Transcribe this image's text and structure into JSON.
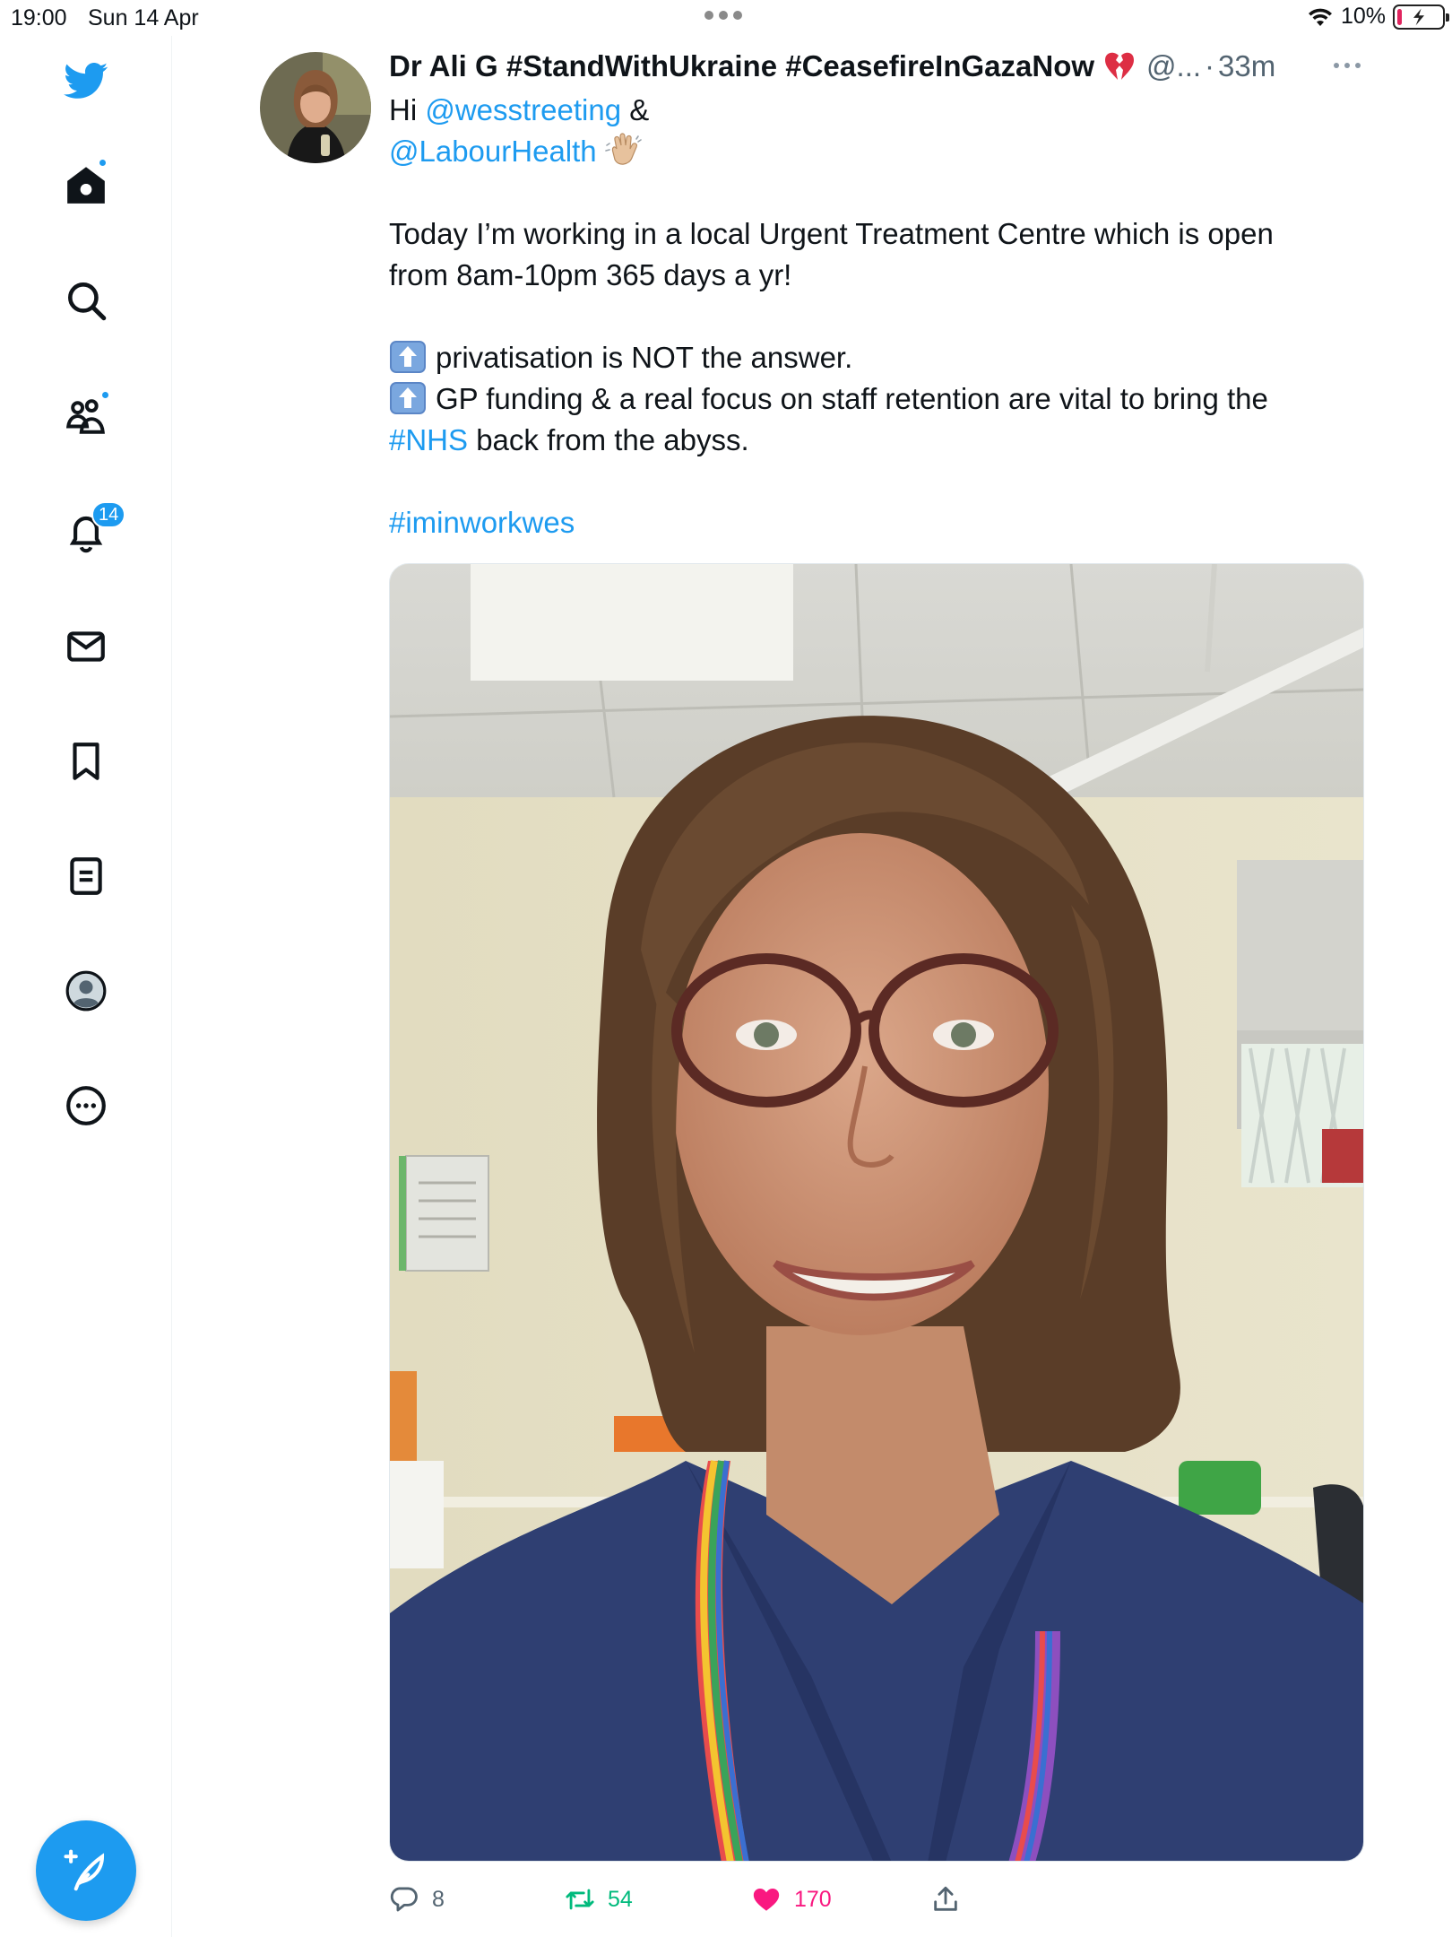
{
  "status_bar": {
    "time": "19:00",
    "date": "Sun 14 Apr",
    "battery": "10%",
    "battery_level": 0.1
  },
  "sidebar": {
    "notifications_badge": "14",
    "items": [
      {
        "name": "twitter-logo-icon"
      },
      {
        "name": "home-icon"
      },
      {
        "name": "search-icon"
      },
      {
        "name": "communities-icon"
      },
      {
        "name": "notifications-bell-icon"
      },
      {
        "name": "messages-envelope-icon"
      },
      {
        "name": "bookmark-icon"
      },
      {
        "name": "lists-icon"
      },
      {
        "name": "profile-icon"
      },
      {
        "name": "more-icon"
      }
    ],
    "compose_icon": "compose-feather-icon"
  },
  "tweet": {
    "display_name": "Dr Ali G #StandWithUkraine #CeasefireInGazaNow",
    "name_emoji": "broken-heart-icon",
    "handle": "@...",
    "separator": "·",
    "time": "33m",
    "body": {
      "greeting_prefix": "Hi ",
      "mention_1": "@wesstreeting",
      "greeting_suffix": " &",
      "mention_2": "@LabourHealth",
      "wave_emoji": "waving-hand-icon",
      "line_1": "Today I’m working in a local Urgent Treatment Centre which is open",
      "line_2": "from 8am-10pm 365 days a yr!",
      "bullet_emoji": "up-arrow-emoji-icon",
      "line_3": "privatisation is NOT the answer.",
      "line_4": "GP funding & a real focus on staff retention are vital to bring the",
      "hashtag_nhs": "#NHS",
      "line_5_suffix": " back from the abyss.",
      "hashtag_2": "#iminworkwes"
    },
    "actions": {
      "replies": "8",
      "retweets": "54",
      "likes": "170"
    }
  },
  "colors": {
    "accent": "#1d9bf0",
    "retweet": "#00ba7c",
    "like": "#f91880",
    "secondary_text": "#536471"
  }
}
